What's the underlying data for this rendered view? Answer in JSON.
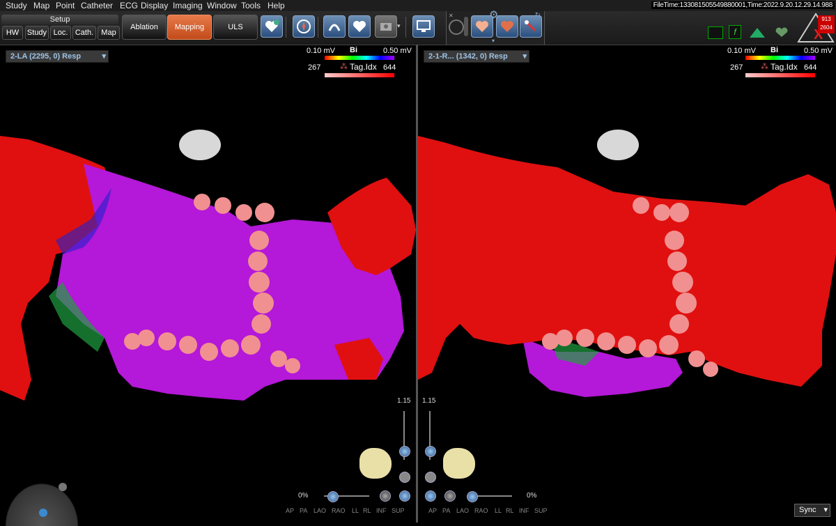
{
  "menu": [
    "Study",
    "Map",
    "Point",
    "Catheter",
    "ECG",
    "Display",
    "Imaging",
    "Window",
    "Tools",
    "Help"
  ],
  "file_time": "FileTime:133081505549880001,Time:2022.9.20.12.29.14.988",
  "setup": {
    "label": "Setup",
    "buttons": [
      "HW",
      "Study",
      "Loc.",
      "Cath.",
      "Map"
    ]
  },
  "modes": {
    "ablation": "Ablation",
    "mapping": "Mapping",
    "uls": "ULS"
  },
  "views": {
    "left": {
      "selector": "2-LA (2295, 0) Resp",
      "bi_min": "0.10 mV",
      "bi_label": "Bi",
      "bi_max": "0.50 mV",
      "tag_min": "267",
      "tag_label": "Tag.Idx",
      "tag_max": "644",
      "zoom": "1.15",
      "pct": "0%"
    },
    "right": {
      "selector": "2-1-R... (1342, 0) Resp",
      "bi_min": "0.10 mV",
      "bi_label": "Bi",
      "bi_max": "0.50 mV",
      "tag_min": "267",
      "tag_label": "Tag.Idx",
      "tag_max": "644",
      "zoom": "1.15",
      "pct": "0%"
    }
  },
  "orientation": [
    "AP",
    "PA",
    "LAO",
    "RAO",
    "LL",
    "RL",
    "INF",
    "SUP"
  ],
  "sync_label": "Sync",
  "status": {
    "tr_top": "913",
    "tr_bottom": "2604"
  },
  "colors": {
    "mapping_active": "#d45a2a",
    "accent_blue": "#4a7ab5",
    "map_red": "#e01010",
    "map_purple": "#b418d8"
  }
}
